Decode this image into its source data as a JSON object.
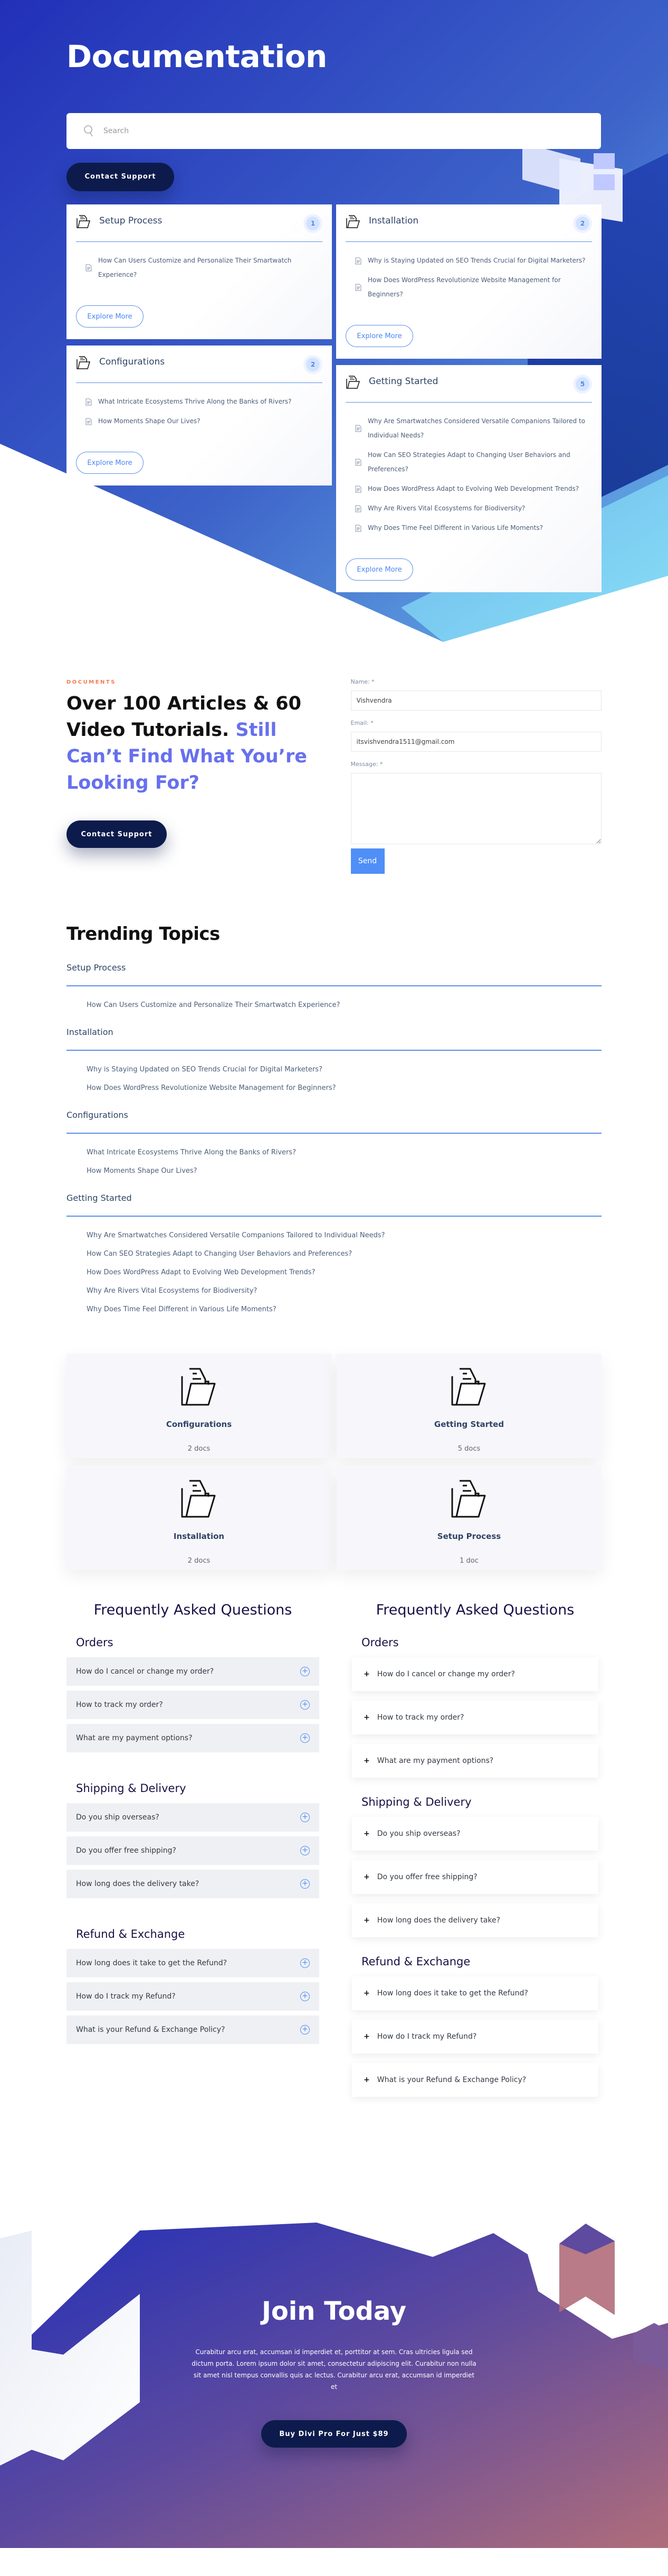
{
  "hero": {
    "title": "Documentation",
    "search_placeholder": "Search",
    "contact_button": "Contact Support",
    "colors": {
      "gradient_top": "#2230b8",
      "gradient_bottom": "#5aa6e6",
      "dark_button": "#0d1b4c"
    }
  },
  "doc_cards": {
    "explore_label": "Explore More",
    "left": [
      {
        "title": "Setup Process",
        "count": "1",
        "articles": [
          "How Can Users Customize and Personalize Their Smartwatch Experience?"
        ]
      },
      {
        "title": "Configurations",
        "count": "2",
        "articles": [
          "What Intricate Ecosystems Thrive Along the Banks of Rivers?",
          "How Moments Shape Our Lives?"
        ]
      }
    ],
    "right": [
      {
        "title": "Installation",
        "count": "2",
        "articles": [
          "Why is Staying Updated on SEO Trends Crucial for Digital Marketers?",
          "How Does WordPress Revolutionize Website Management for Beginners?"
        ]
      },
      {
        "title": "Getting Started",
        "count": "5",
        "articles": [
          "Why Are Smartwatches Considered Versatile Companions Tailored to Individual Needs?",
          "How Can SEO Strategies Adapt to Changing User Behaviors and Preferences?",
          "How Does WordPress Adapt to Evolving Web Development Trends?",
          "Why Are Rivers Vital Ecosystems for Biodiversity?",
          "Why Does Time Feel Different in Various Life Moments?"
        ]
      }
    ]
  },
  "contact": {
    "eyebrow": "DOCUMENTS",
    "heading_dark": "Over 100 Articles & 60 Video Tutorials. ",
    "heading_accent": "Still Can’t Find What You’re Looking For?",
    "button": "Contact Support",
    "accent_color": "#6770ee",
    "form": {
      "name_label": "Name: *",
      "name_value": "Vishvendra",
      "email_label": "Email: *",
      "email_value": "itsvishvendra1511@gmail.com",
      "message_label": "Message: *",
      "message_value": "",
      "send_label": "Send"
    }
  },
  "trending": {
    "title": "Trending Topics",
    "groups": [
      {
        "category": "Setup Process",
        "articles": [
          "How Can Users Customize and Personalize Their Smartwatch Experience?"
        ]
      },
      {
        "category": "Installation",
        "articles": [
          "Why is Staying Updated on SEO Trends Crucial for Digital Marketers?",
          "How Does WordPress Revolutionize Website Management for Beginners?"
        ]
      },
      {
        "category": "Configurations",
        "articles": [
          "What Intricate Ecosystems Thrive Along the Banks of Rivers?",
          "How Moments Shape Our Lives?"
        ]
      },
      {
        "category": "Getting Started",
        "articles": [
          "Why Are Smartwatches Considered Versatile Companions Tailored to Individual Needs?",
          "How Can SEO Strategies Adapt to Changing User Behaviors and Preferences?",
          "How Does WordPress Adapt to Evolving Web Development Trends?",
          "Why Are Rivers Vital Ecosystems for Biodiversity?",
          "Why Does Time Feel Different in Various Life Moments?"
        ]
      }
    ]
  },
  "tiles": [
    {
      "title": "Configurations",
      "count": "2 docs"
    },
    {
      "title": "Getting Started",
      "count": "5 docs"
    },
    {
      "title": "Installation",
      "count": "2 docs"
    },
    {
      "title": "Setup Process",
      "count": "1 doc"
    }
  ],
  "faq": {
    "title": "Frequently Asked Questions",
    "sections": [
      {
        "title": "Orders",
        "questions": [
          "How do I cancel or change my order?",
          "How to track my order?",
          "What are my payment options?"
        ]
      },
      {
        "title": "Shipping & Delivery",
        "questions": [
          "Do you ship overseas?",
          "Do you offer free shipping?",
          "How long does the delivery take?"
        ]
      },
      {
        "title": "Refund & Exchange",
        "questions": [
          "How long does it take to get the Refund?",
          "How do I track my Refund?",
          "What is your Refund & Exchange Policy?"
        ]
      }
    ]
  },
  "join": {
    "title": "Join Today",
    "text": "Curabitur arcu erat, accumsan id imperdiet et, porttitor at sem. Cras ultricies ligula sed dictum porta. Lorem ipsum dolor sit amet, consectetur adipiscing elit. Curabitur non nulla sit amet nisl tempus convallis quis ac lectus. Curabitur arcu erat, accumsan id imperdiet et",
    "button": "Buy Divi Pro For Just $89",
    "colors": {
      "gradient_start": "#2230b8",
      "gradient_end": "#b06d7a"
    }
  }
}
